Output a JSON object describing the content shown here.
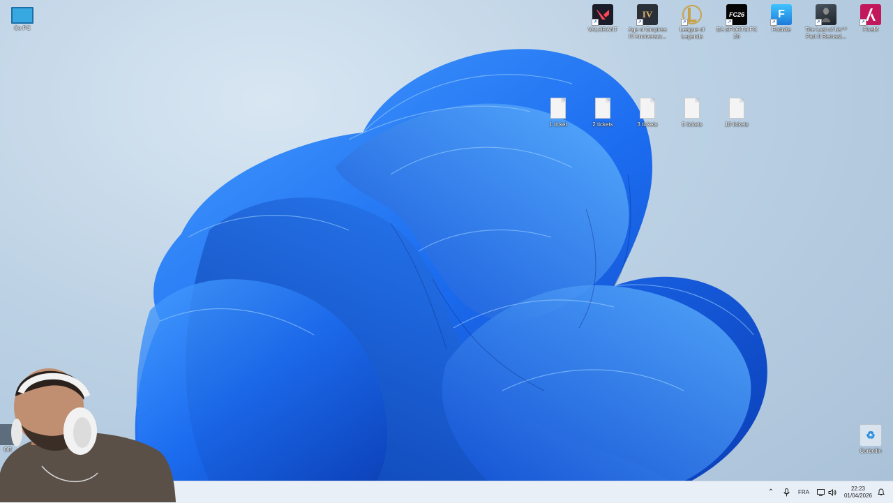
{
  "desktop_icons": {
    "this_pc": "Ce PC",
    "valorant": "VALORANT",
    "age_of_empires": "Age of Empires IV Anniversar...",
    "league_of_legends": "League of Legends",
    "ea_fc": "EA SPORTS FC 26",
    "fortnite": "Fortnite",
    "last_of_us": "The Last of Us™ Part II Remast...",
    "fivem": "FiveM",
    "recycle_bin": "Corbeille",
    "partial_left": "OB"
  },
  "files": [
    "1 ticket",
    "2 tickets",
    "3 tickets",
    "5 tickets",
    "10 tickets"
  ],
  "icon_glyphs": {
    "aoe": "IV",
    "fc": "FC26",
    "fortnite": "F"
  },
  "taskbar": {
    "language": "FRA",
    "time": "22:23",
    "date": "01/04/2026"
  },
  "colors": {
    "wallpaper_blue": "#1f63e0",
    "taskbar": "#e9eff7",
    "valorant": "#1c1c28",
    "fivem": "#c2185b"
  }
}
